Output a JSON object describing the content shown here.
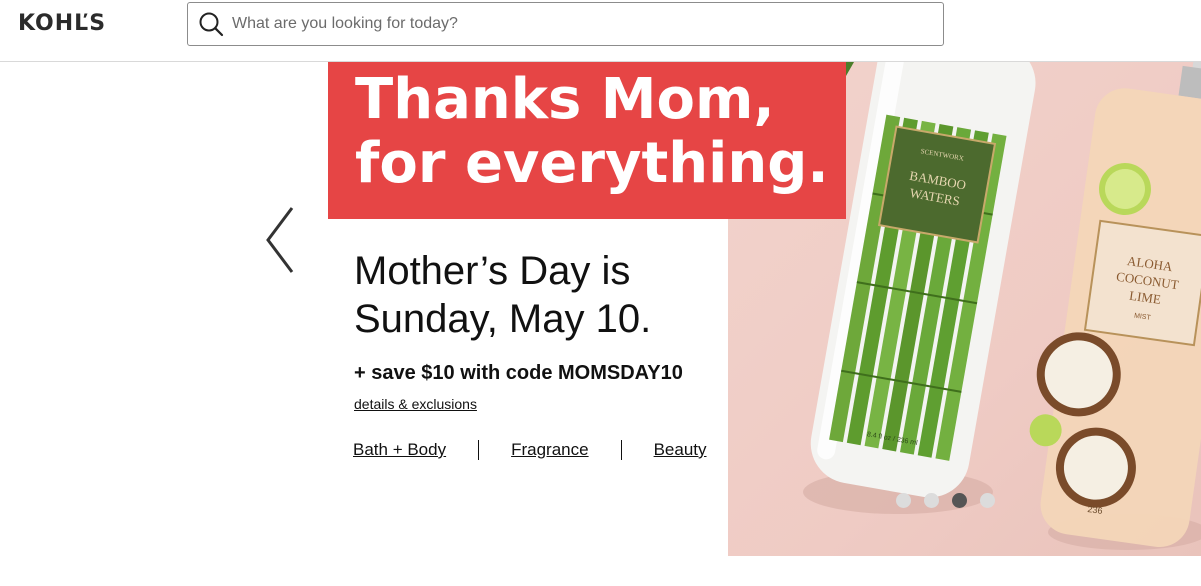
{
  "header": {
    "logo_text": "KOHĽS",
    "search": {
      "placeholder": "What are you looking for today?",
      "value": ""
    }
  },
  "hero": {
    "headline": "Thanks Mom,\nfor everything.",
    "subheadline": "Mother’s Day is\nSunday, May 10.",
    "promo": "+ save $10 with code MOMSDAY10",
    "details_link": "details & exclusions",
    "categories": [
      {
        "label": "Bath + Body"
      },
      {
        "label": "Fragrance"
      },
      {
        "label": "Beauty"
      }
    ],
    "carousel": {
      "slide_count": 4,
      "active_index": 2
    },
    "product_labels": {
      "bottle1_brand": "SCENTWORX",
      "bottle1_name": "BAMBOO\nWATERS",
      "bottle1_size": "8.4 fl oz / 236 ml",
      "bottle2_name": "ALOHA\nCOCONUT\nLIME",
      "bottle2_type": "MIST",
      "bottle2_size": "236"
    }
  },
  "colors": {
    "banner_red": "#e64545",
    "photo_bg": "#efcbc4",
    "dot_active": "#555555",
    "dot_inactive": "#dcdcdc"
  }
}
